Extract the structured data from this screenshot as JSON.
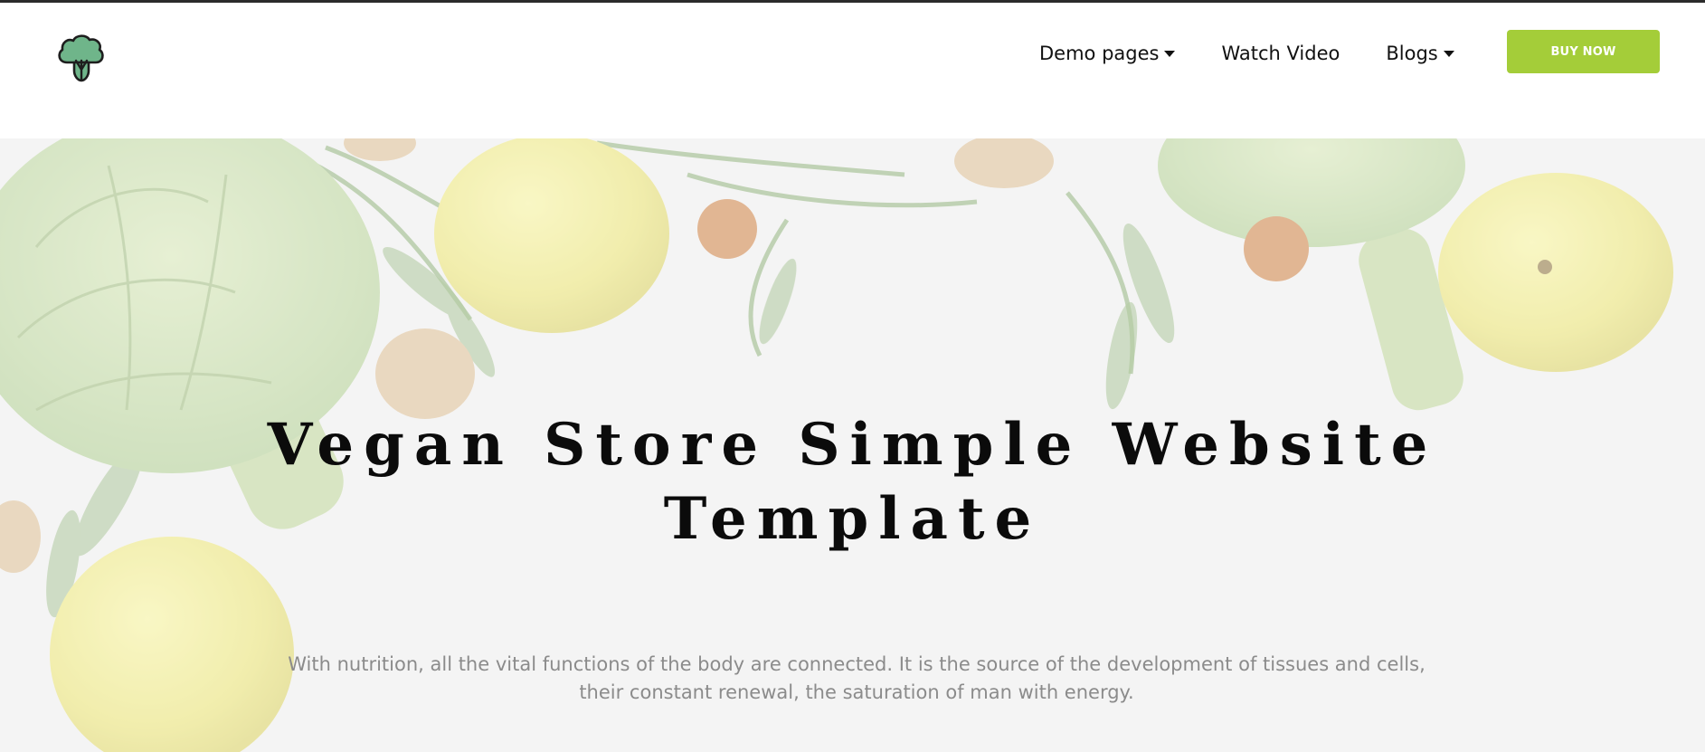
{
  "header": {
    "logo_icon": "broccoli-tree-icon",
    "nav": [
      {
        "label": "Demo pages",
        "dropdown": true
      },
      {
        "label": "Watch Video",
        "dropdown": false
      },
      {
        "label": "Blogs",
        "dropdown": true
      }
    ],
    "buy_label": "BUY NOW"
  },
  "hero": {
    "title_line1": "Vegan Store Simple Website",
    "title_line2": "Template",
    "desc_line1": "With nutrition, all the vital functions of the body are connected. It is the source of the development of tissues and cells,",
    "desc_line2": "their constant renewal, the saturation of man with energy."
  },
  "colors": {
    "accent": "#a4cd39",
    "topline": "#2b2b2b",
    "text": "#111111",
    "muted": "#8b8b8b"
  }
}
